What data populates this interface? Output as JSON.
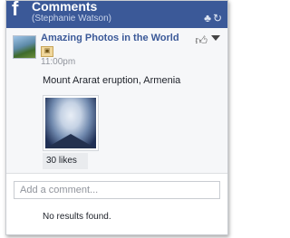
{
  "window": {
    "title": "Comments",
    "subtitle": "(Stephanie Watson)",
    "brand_icon": "f"
  },
  "post": {
    "page_name": "Amazing Photos in the World",
    "timestamp": "11:00pm",
    "caption": "Mount Ararat eruption, Armenia",
    "likes": "30 likes"
  },
  "comment": {
    "placeholder": "Add a comment...",
    "no_results": "No results found."
  }
}
